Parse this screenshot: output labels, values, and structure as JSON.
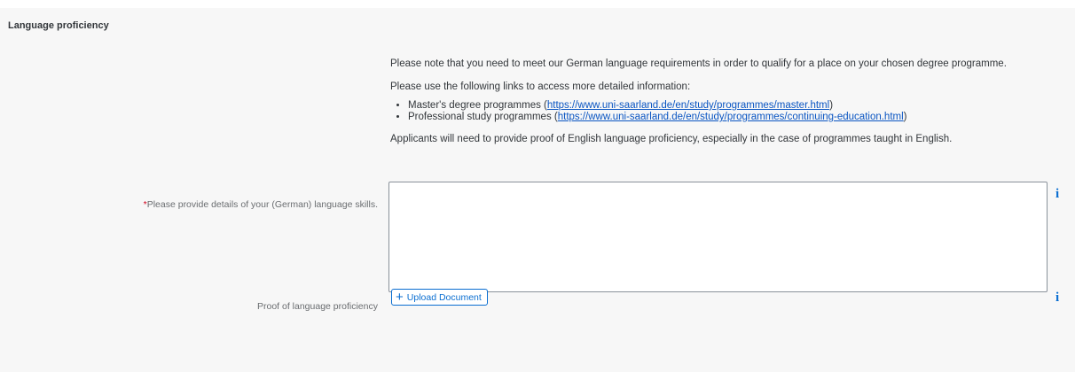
{
  "section": {
    "title": "Language proficiency"
  },
  "info": {
    "paragraph1": "Please note that you need to meet our German language requirements in order to qualify for a place on your chosen degree programme.",
    "paragraph2": "Please use the following links to access more detailed information:",
    "links": [
      {
        "prefix": "Master's degree programmes (",
        "url": "https://www.uni-saarland.de/en/study/programmes/master.html",
        "suffix": ")"
      },
      {
        "prefix": "Professional study programmes (",
        "url": "https://www.uni-saarland.de/en/study/programmes/continuing-education.html",
        "suffix": ")"
      }
    ],
    "paragraph3": "Applicants will need to provide proof of English language proficiency, especially in the case of programmes taught in English."
  },
  "form": {
    "details_required_marker": "*",
    "details_label": "Please provide details of your (German) language skills.",
    "details_value": "",
    "proof_label": "Proof of language proficiency",
    "upload_button_label": "Upload Document",
    "info_icon_glyph": "i"
  },
  "colors": {
    "accent": "#0a6ed1",
    "link": "#0a55c2",
    "required": "#d0021b",
    "panel_bg": "#f7f7f7"
  },
  "icons": [
    "info-icon",
    "plus-icon"
  ]
}
